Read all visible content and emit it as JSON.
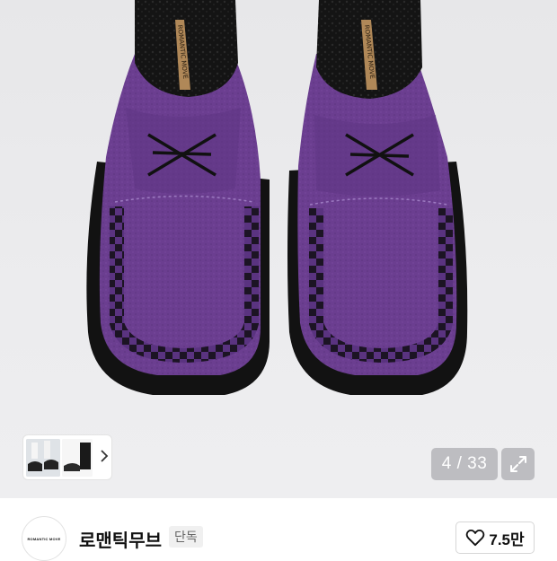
{
  "gallery": {
    "counter": "4 / 33",
    "expand_icon": "expand-icon",
    "thumbnail_chevron": "chevron-right-icon"
  },
  "shoe": {
    "insole_text": "ROMANTIC MOVE",
    "color": "#6a3d8f",
    "sole_color": "#1a1a1a"
  },
  "brand": {
    "logo_text": "ROMANTIC MOVE",
    "name": "로맨틱무브",
    "badge": "단독",
    "like_count": "7.5만",
    "like_icon": "heart-outline-icon"
  }
}
